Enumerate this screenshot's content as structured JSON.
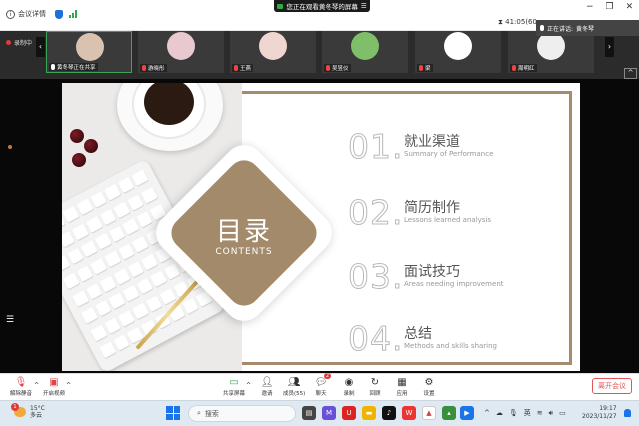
{
  "window": {
    "meeting_details": "会议详情",
    "viewing_banner": "您正在观看黄冬琴的屏幕",
    "timer": "41:05(60",
    "speaking_label": "正在讲话:",
    "speaking_name": "黄冬琴"
  },
  "strip": {
    "rec_label": "录制中",
    "participants": [
      {
        "name": "黄冬琴正在共享",
        "active": true,
        "avatar_color": "#d9c2b0"
      },
      {
        "name": "游晓彤",
        "active": false,
        "avatar_color": "#e8c9cf"
      },
      {
        "name": "王燕",
        "active": false,
        "avatar_color": "#f0d6d0"
      },
      {
        "name": "吴昱仪",
        "active": false,
        "avatar_color": "#7fbf6a"
      },
      {
        "name": "梁",
        "active": false,
        "avatar_color": "#ffffff"
      },
      {
        "name": "周明红",
        "active": false,
        "avatar_color": "#eeeeee"
      }
    ]
  },
  "slide": {
    "title": "目录",
    "subtitle": "CONTENTS",
    "items": [
      {
        "num": "01.",
        "title": "就业渠道",
        "sub": "Summary of Performance"
      },
      {
        "num": "02.",
        "title": "简历制作",
        "sub": "Lessons learned analysis"
      },
      {
        "num": "03.",
        "title": "面试技巧",
        "sub": "Areas needing improvement"
      },
      {
        "num": "04.",
        "title": "总结",
        "sub": "Methods and skills sharing"
      }
    ],
    "accent": "#a28a6a"
  },
  "controls": {
    "unmute": "解除静音",
    "start_video": "开启视频",
    "share": "共享屏幕",
    "invite": "邀请",
    "members": "成员(55)",
    "chat": "聊天",
    "chat_badge": "2",
    "record": "录制",
    "review": "回顾",
    "apps": "应用",
    "settings": "设置",
    "leave": "离开会议"
  },
  "taskbar": {
    "temp": "15°C",
    "weather": "多云",
    "weather_badge": "1",
    "search_placeholder": "搜索",
    "ime": "英",
    "time": "19:17",
    "date": "2023/11/27"
  }
}
